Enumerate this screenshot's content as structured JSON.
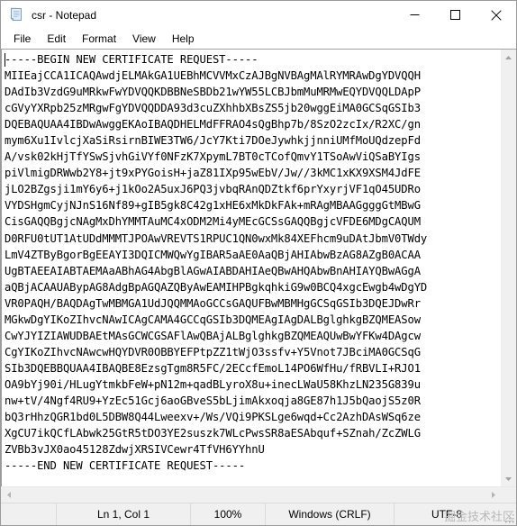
{
  "window": {
    "title": "csr - Notepad",
    "icon": "notepad-icon",
    "controls": {
      "minimize": "Minimize",
      "maximize": "Maximize",
      "close": "Close"
    }
  },
  "menu": {
    "items": [
      {
        "label": "File"
      },
      {
        "label": "Edit"
      },
      {
        "label": "Format"
      },
      {
        "label": "View"
      },
      {
        "label": "Help"
      }
    ]
  },
  "editor": {
    "lines": [
      "-----BEGIN NEW CERTIFICATE REQUEST-----",
      "MIIEajCCA1ICAQAwdjELMAkGA1UEBhMCVVMxCzAJBgNVBAgMAlRYMRAwDgYDVQQH",
      "DAdIb3VzdG9uMRkwFwYDVQQKDBBNeSBDb21wYW55LCBJbmMuMRMwEQYDVQQLDApP",
      "cGVyYXRpb25zMRgwFgYDVQQDDA93d3cuZXhhbXBsZS5jb20wggEiMA0GCSqGSIb3",
      "DQEBAQUAA4IBDwAwggEKAoIBAQDHELMdFFRAO4sQgBhp7b/8SzO2zcIx/R2XC/gn",
      "mym6Xu1IvlcjXaSiRsirnBIWE3TW6/JcY7Kti7DOeJywhkjjnniUMfMoUQdzepFd",
      "A/vsk02kHjTfYSwSjvhGiVYf0NFzK7XpymL7BT0cTCofQmvY1TSoAwViQSaBYIgs",
      "piVlmigDRWwb2Y8+jt9xPYGoisH+jaZ81IXp95wEbV/Jw//3kMC1xKX9XSM4JdFE",
      "jLO2BZgsji1mY6y6+j1kOo2A5uxJ6PQ3jvbqRAnQDZtkf6prYxyrjVF1qO45UDRo",
      "VYDSHgmCyjNJnS16Nf89+gIB5gk8C42g1xHE6xMkDkFAk+mRAgMBAAGgggGtMBwG",
      "CisGAQQBgjcNAgMxDhYMMTAuMC4xODM2Mi4yMEcGCSsGAQQBgjcVFDE6MDgCAQUM",
      "D0RFU0tUT1AtUDdMMMTJPOAwVREVTS1RPUC1QN0wxMk84XEFhcm9uDAtJbmV0TWdy",
      "LmV4ZTByBgorBgEEAYI3DQICMWQwYgIBAR5aAE0AaQBjAHIAbwBzAG8AZgB0ACAA",
      "UgBTAEEAIABTAEMAaABhAG4AbgBlAGwAIABDAHIAeQBwAHQAbwBnAHIAYQBwAGgA",
      "aQBjACAAUABypAG8AdgBpAGQAZQByAwEAMIHPBgkqhkiG9w0BCQ4xgcEwgb4wDgYD",
      "VR0PAQH/BAQDAgTwMBMGA1UdJQQMMAoGCCsGAQUFBwMBMHgGCSqGSIb3DQEJDwRr",
      "MGkwDgYIKoZIhvcNAwICAgCAMA4GCCqGSIb3DQMEAgIAgDALBglghkgBZQMEASow",
      "CwYJYIZIAWUDBAEtMAsGCWCGSAFlAwQBAjALBglghkgBZQMEAQUwBwYFKw4DAgcw",
      "CgYIKoZIhvcNAwcwHQYDVR0OBBYEFPtpZZ1tWjO3ssfv+Y5Vnot7JBciMA0GCSqG",
      "SIb3DQEBBQUAA4IBAQBE8EzsgTgm8R5FC/2ECcfEmoL14PO6WfHu/fRBVLI+RJO1",
      "OA9bYj90i/HLugYtmkbFeW+pN12m+qadBLyroX8u+inecLWaU58KhzLN235G839u",
      "nw+tV/4Ngf4RU9+YzEc51Gcj6aoGBveS5bLjimAkxoqja8GE87h1J5bQaojS5z0R",
      "bQ3rHhzQGR1bd0L5DBW8Q44Lweexv+/Ws/VQi9PKSLge6wqd+Cc2AzhDAsWSq6ze",
      "XgCU7ikQCfLAbwk25GtR5tDO3YE2suszk7WLcPwsSR8aESAbquf+SZnah/ZcZWLG",
      "ZVBb3vJX0ao45128ZdwjXRSIVCewr4TfVH6YYhnU",
      "-----END NEW CERTIFICATE REQUEST-----"
    ]
  },
  "scrollbars": {
    "vertical_up": "scroll-up-arrow",
    "vertical_down": "scroll-down-arrow",
    "horizontal_left": "scroll-left-arrow",
    "horizontal_right": "scroll-right-arrow"
  },
  "statusbar": {
    "cursor_position": "Ln 1, Col 1",
    "zoom": "100%",
    "line_ending": "Windows (CRLF)",
    "encoding": "UTF-8"
  },
  "watermark": {
    "text": "掘金技术社区"
  }
}
